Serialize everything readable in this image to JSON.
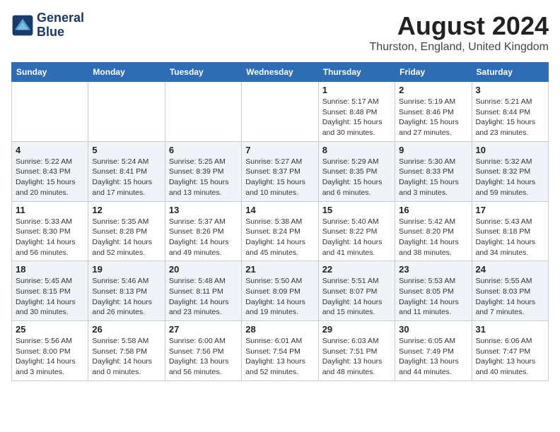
{
  "header": {
    "logo_line1": "General",
    "logo_line2": "Blue",
    "month_year": "August 2024",
    "location": "Thurston, England, United Kingdom"
  },
  "days_of_week": [
    "Sunday",
    "Monday",
    "Tuesday",
    "Wednesday",
    "Thursday",
    "Friday",
    "Saturday"
  ],
  "weeks": [
    [
      {
        "num": "",
        "info": ""
      },
      {
        "num": "",
        "info": ""
      },
      {
        "num": "",
        "info": ""
      },
      {
        "num": "",
        "info": ""
      },
      {
        "num": "1",
        "info": "Sunrise: 5:17 AM\nSunset: 8:48 PM\nDaylight: 15 hours\nand 30 minutes."
      },
      {
        "num": "2",
        "info": "Sunrise: 5:19 AM\nSunset: 8:46 PM\nDaylight: 15 hours\nand 27 minutes."
      },
      {
        "num": "3",
        "info": "Sunrise: 5:21 AM\nSunset: 8:44 PM\nDaylight: 15 hours\nand 23 minutes."
      }
    ],
    [
      {
        "num": "4",
        "info": "Sunrise: 5:22 AM\nSunset: 8:43 PM\nDaylight: 15 hours\nand 20 minutes."
      },
      {
        "num": "5",
        "info": "Sunrise: 5:24 AM\nSunset: 8:41 PM\nDaylight: 15 hours\nand 17 minutes."
      },
      {
        "num": "6",
        "info": "Sunrise: 5:25 AM\nSunset: 8:39 PM\nDaylight: 15 hours\nand 13 minutes."
      },
      {
        "num": "7",
        "info": "Sunrise: 5:27 AM\nSunset: 8:37 PM\nDaylight: 15 hours\nand 10 minutes."
      },
      {
        "num": "8",
        "info": "Sunrise: 5:29 AM\nSunset: 8:35 PM\nDaylight: 15 hours\nand 6 minutes."
      },
      {
        "num": "9",
        "info": "Sunrise: 5:30 AM\nSunset: 8:33 PM\nDaylight: 15 hours\nand 3 minutes."
      },
      {
        "num": "10",
        "info": "Sunrise: 5:32 AM\nSunset: 8:32 PM\nDaylight: 14 hours\nand 59 minutes."
      }
    ],
    [
      {
        "num": "11",
        "info": "Sunrise: 5:33 AM\nSunset: 8:30 PM\nDaylight: 14 hours\nand 56 minutes."
      },
      {
        "num": "12",
        "info": "Sunrise: 5:35 AM\nSunset: 8:28 PM\nDaylight: 14 hours\nand 52 minutes."
      },
      {
        "num": "13",
        "info": "Sunrise: 5:37 AM\nSunset: 8:26 PM\nDaylight: 14 hours\nand 49 minutes."
      },
      {
        "num": "14",
        "info": "Sunrise: 5:38 AM\nSunset: 8:24 PM\nDaylight: 14 hours\nand 45 minutes."
      },
      {
        "num": "15",
        "info": "Sunrise: 5:40 AM\nSunset: 8:22 PM\nDaylight: 14 hours\nand 41 minutes."
      },
      {
        "num": "16",
        "info": "Sunrise: 5:42 AM\nSunset: 8:20 PM\nDaylight: 14 hours\nand 38 minutes."
      },
      {
        "num": "17",
        "info": "Sunrise: 5:43 AM\nSunset: 8:18 PM\nDaylight: 14 hours\nand 34 minutes."
      }
    ],
    [
      {
        "num": "18",
        "info": "Sunrise: 5:45 AM\nSunset: 8:15 PM\nDaylight: 14 hours\nand 30 minutes."
      },
      {
        "num": "19",
        "info": "Sunrise: 5:46 AM\nSunset: 8:13 PM\nDaylight: 14 hours\nand 26 minutes."
      },
      {
        "num": "20",
        "info": "Sunrise: 5:48 AM\nSunset: 8:11 PM\nDaylight: 14 hours\nand 23 minutes."
      },
      {
        "num": "21",
        "info": "Sunrise: 5:50 AM\nSunset: 8:09 PM\nDaylight: 14 hours\nand 19 minutes."
      },
      {
        "num": "22",
        "info": "Sunrise: 5:51 AM\nSunset: 8:07 PM\nDaylight: 14 hours\nand 15 minutes."
      },
      {
        "num": "23",
        "info": "Sunrise: 5:53 AM\nSunset: 8:05 PM\nDaylight: 14 hours\nand 11 minutes."
      },
      {
        "num": "24",
        "info": "Sunrise: 5:55 AM\nSunset: 8:03 PM\nDaylight: 14 hours\nand 7 minutes."
      }
    ],
    [
      {
        "num": "25",
        "info": "Sunrise: 5:56 AM\nSunset: 8:00 PM\nDaylight: 14 hours\nand 3 minutes."
      },
      {
        "num": "26",
        "info": "Sunrise: 5:58 AM\nSunset: 7:58 PM\nDaylight: 14 hours\nand 0 minutes."
      },
      {
        "num": "27",
        "info": "Sunrise: 6:00 AM\nSunset: 7:56 PM\nDaylight: 13 hours\nand 56 minutes."
      },
      {
        "num": "28",
        "info": "Sunrise: 6:01 AM\nSunset: 7:54 PM\nDaylight: 13 hours\nand 52 minutes."
      },
      {
        "num": "29",
        "info": "Sunrise: 6:03 AM\nSunset: 7:51 PM\nDaylight: 13 hours\nand 48 minutes."
      },
      {
        "num": "30",
        "info": "Sunrise: 6:05 AM\nSunset: 7:49 PM\nDaylight: 13 hours\nand 44 minutes."
      },
      {
        "num": "31",
        "info": "Sunrise: 6:06 AM\nSunset: 7:47 PM\nDaylight: 13 hours\nand 40 minutes."
      }
    ]
  ]
}
